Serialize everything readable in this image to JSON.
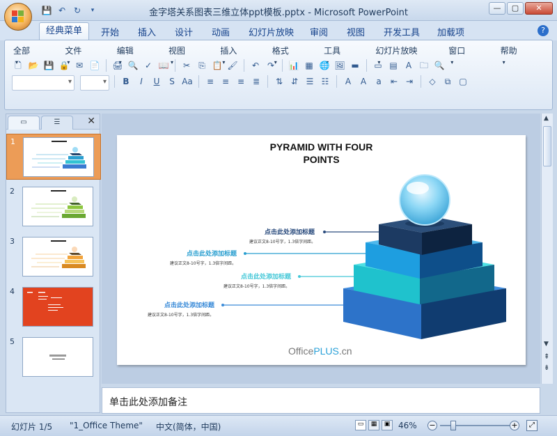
{
  "window": {
    "title": "金字塔关系图表三维立体ppt模板.pptx - Microsoft PowerPoint",
    "controls": [
      "—",
      "▢",
      "✕"
    ]
  },
  "ribbon_tabs": [
    "经典菜单",
    "开始",
    "插入",
    "设计",
    "动画",
    "幻灯片放映",
    "审阅",
    "视图",
    "开发工具",
    "加载项"
  ],
  "classic_menu": [
    "全部",
    "文件",
    "编辑",
    "视图",
    "插入",
    "格式",
    "工具",
    "幻灯片放映",
    "窗口",
    "帮助"
  ],
  "slides_panel": {
    "slides": [
      {
        "number": "1"
      },
      {
        "number": "2"
      },
      {
        "number": "3"
      },
      {
        "number": "4"
      },
      {
        "number": "5"
      }
    ]
  },
  "slide": {
    "title_line1": "PYRAMID WITH FOUR",
    "title_line2": "POINTS",
    "callouts": [
      {
        "title": "点击此处添加标题",
        "desc": "建议正文8-10号字，1.3倍字间距。",
        "color": "#2b4c7e"
      },
      {
        "title": "点击此处添加标题",
        "desc": "建议正文8-10号字，1.3倍字间距。",
        "color": "#2a9fd0"
      },
      {
        "title": "点击此处添加标题",
        "desc": "建议正文8-10号字，1.3倍字间距。",
        "color": "#45c8d8"
      },
      {
        "title": "点击此处添加标题",
        "desc": "建议正文8-10号字，1.3倍字间距。",
        "color": "#3a8bd8"
      }
    ],
    "brand_office": "Office",
    "brand_plus": "PLUS",
    "brand_cn": ".cn"
  },
  "notes_placeholder": "单击此处添加备注",
  "status": {
    "slide_count": "幻灯片 1/5",
    "theme": "\"1_Office Theme\"",
    "language": "中文(简体，中国)",
    "zoom": "46%"
  }
}
